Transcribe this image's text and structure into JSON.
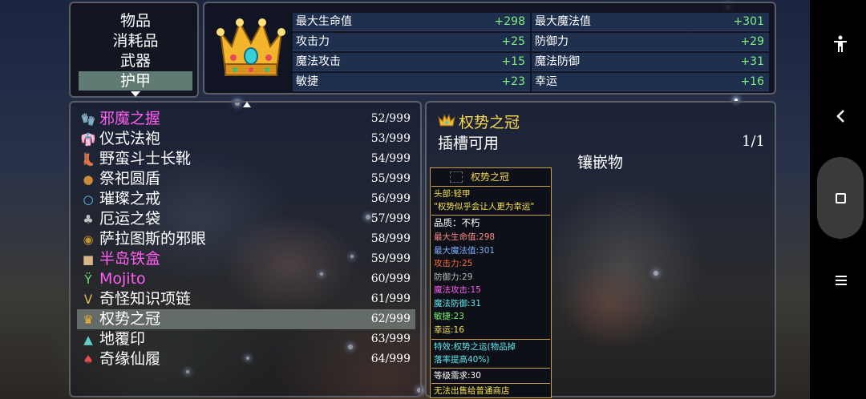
{
  "categories": {
    "items": [
      "物品",
      "消耗品",
      "武器",
      "护甲"
    ],
    "selected_index": 3
  },
  "stats": {
    "left": [
      {
        "label": "最大生命值",
        "value": "+298"
      },
      {
        "label": "攻击力",
        "value": "+25"
      },
      {
        "label": "魔法攻击",
        "value": "+15"
      },
      {
        "label": "敏捷",
        "value": "+23"
      }
    ],
    "right": [
      {
        "label": "最大魔法值",
        "value": "+301"
      },
      {
        "label": "防御力",
        "value": "+29"
      },
      {
        "label": "魔法防御",
        "value": "+31"
      },
      {
        "label": "幸运",
        "value": "+16"
      }
    ]
  },
  "items": [
    {
      "name": "邪魔之握",
      "count": "52/999",
      "color": "#ff5ef0",
      "icon": "gauntlet-icon"
    },
    {
      "name": "仪式法袍",
      "count": "53/999",
      "color": "#ffffff",
      "icon": "robe-icon"
    },
    {
      "name": "野蛮斗士长靴",
      "count": "54/999",
      "color": "#ffffff",
      "icon": "boots-icon"
    },
    {
      "name": "祭祀圆盾",
      "count": "55/999",
      "color": "#ffffff",
      "icon": "round-shield-icon"
    },
    {
      "name": "璀璨之戒",
      "count": "56/999",
      "color": "#ffffff",
      "icon": "ring-icon"
    },
    {
      "name": "厄运之袋",
      "count": "57/999",
      "color": "#ffffff",
      "icon": "bag-icon"
    },
    {
      "name": "萨拉图斯的邪眼",
      "count": "58/999",
      "color": "#ffffff",
      "icon": "evil-eye-icon"
    },
    {
      "name": "半岛铁盒",
      "count": "59/999",
      "color": "#ff5ef0",
      "icon": "iron-box-icon"
    },
    {
      "name": "Mojito",
      "count": "60/999",
      "color": "#ff5ef0",
      "icon": "cocktail-icon"
    },
    {
      "name": "奇怪知识项链",
      "count": "61/999",
      "color": "#ffffff",
      "icon": "necklace-icon"
    },
    {
      "name": "权势之冠",
      "count": "62/999",
      "color": "#ffffff",
      "icon": "crown-icon"
    },
    {
      "name": "地覆印",
      "count": "63/999",
      "color": "#ffffff",
      "icon": "seal-icon"
    },
    {
      "name": "奇缘仙履",
      "count": "64/999",
      "color": "#ffffff",
      "icon": "slipper-icon"
    }
  ],
  "selected_item_index": 10,
  "detail": {
    "title": "权势之冠",
    "socket_label": "插槽可用",
    "count": "1/1",
    "inlay_label": "镶嵌物"
  },
  "tooltip": {
    "title": "权势之冠",
    "part": "头部:轻甲",
    "quote": "\"权势似乎会让人更为幸运\"",
    "quality": "品质：不朽",
    "stats": [
      {
        "text": "最大生命值:298",
        "color": "#ff8a8a"
      },
      {
        "text": "最大魔法值:301",
        "color": "#7db0ff"
      },
      {
        "text": "攻击力:25",
        "color": "#ff6a3a"
      },
      {
        "text": "防御力:29",
        "color": "#bbbbbb"
      },
      {
        "text": "魔法攻击:15",
        "color": "#ff5ef0"
      },
      {
        "text": "魔法防御:31",
        "color": "#63e8ef"
      },
      {
        "text": "敏捷:23",
        "color": "#79ef6c"
      },
      {
        "text": "幸运:16",
        "color": "#f7e34a"
      }
    ],
    "effect_line1": "特效:权势之运(物品掉",
    "effect_line2": "落率提高40%)",
    "level": "等级需求:30",
    "shop": "无法出售给普通商店"
  },
  "colors": {
    "stat_value": "#7cf07c",
    "highlight_title": "#f7d84f",
    "rarity_pink": "#ff5ef0",
    "tooltip_border": "#c9a24a"
  }
}
